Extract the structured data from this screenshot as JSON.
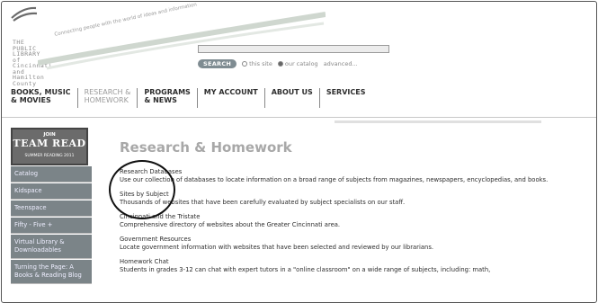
{
  "logo": {
    "text": "THE\nPUBLIC\nLIBRARY\nof Cincinnati\nand\nHamilton County",
    "tagline": "Connecting people with the world of ideas and information"
  },
  "search": {
    "placeholder": "",
    "button_label": "SEARCH",
    "options": [
      {
        "label": "this site",
        "selected": false
      },
      {
        "label": "our catalog",
        "selected": true
      }
    ],
    "advanced_label": "advanced..."
  },
  "topnav": [
    {
      "label": "BOOKS, MUSIC\n& MOVIES",
      "active": false
    },
    {
      "label": "RESEARCH &\nHOMEWORK",
      "active": true
    },
    {
      "label": "PROGRAMS\n& NEWS",
      "active": false
    },
    {
      "label": "MY ACCOUNT",
      "active": false
    },
    {
      "label": "ABOUT US",
      "active": false
    },
    {
      "label": "SERVICES",
      "active": false
    }
  ],
  "promo": {
    "line1": "JOIN",
    "line2": "TEAM READ",
    "line3": "SUMMER READING 2011"
  },
  "sidebar": [
    "Catalog",
    "Kidspace",
    "Teenspace",
    "Fifty - Five +",
    "Virtual Library &\nDownloadables",
    "Turning the Page: A\nBooks & Reading Blog"
  ],
  "main": {
    "title": "Research & Homework",
    "entries": [
      {
        "title": "Research Databases",
        "desc": "Use our collection of databases to locate information on a broad range of subjects from magazines, newspapers, encyclopedias, and books."
      },
      {
        "title": "Sites by Subject",
        "desc": "Thousands of websites that have been carefully evaluated by subject specialists on our staff."
      },
      {
        "title": "Cincinnati and the Tristate",
        "desc": "Comprehensive directory of websites about the Greater Cincinnati area."
      },
      {
        "title": "Government Resources",
        "desc": "Locate government information with websites that have been selected and reviewed by our librarians."
      },
      {
        "title": "Homework Chat",
        "desc": "Students in grades 3-12 can chat with expert tutors in a \"online classroom\" on a wide range of subjects, including: math,"
      }
    ]
  }
}
